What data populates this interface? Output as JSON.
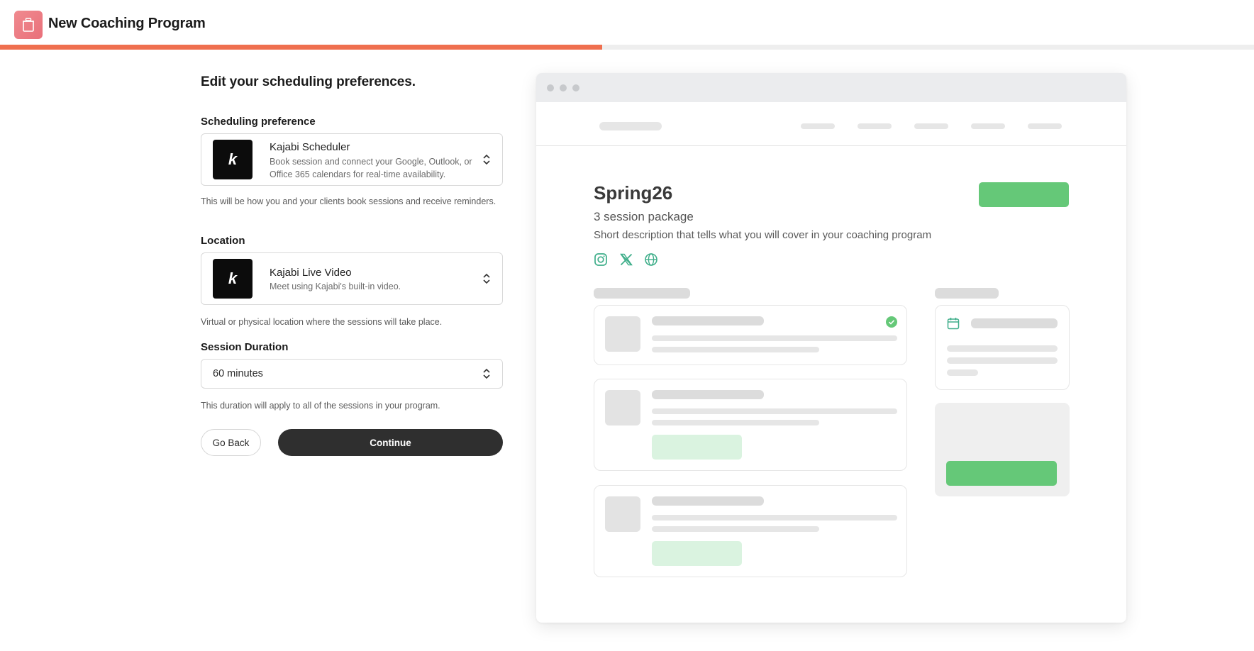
{
  "header": {
    "title": "New Coaching Program",
    "progress_fraction": 0.48,
    "progress_color": "#ef6f4f",
    "icon": "trash-can-icon"
  },
  "form": {
    "heading": "Edit your scheduling preferences.",
    "scheduling": {
      "label": "Scheduling preference",
      "selected_title": "Kajabi Scheduler",
      "selected_desc": "Book session and connect your Google, Outlook, or Office 365 calendars for real-time availability.",
      "logo_text": "k",
      "help": "This will be how you and your clients book sessions and receive reminders."
    },
    "location": {
      "label": "Location",
      "selected_title": "Kajabi Live Video",
      "selected_desc": "Meet using Kajabi's built-in video.",
      "logo_text": "k",
      "help": "Virtual or physical location where the sessions will take place."
    },
    "duration": {
      "label": "Session Duration",
      "value": "60 minutes",
      "help": "This duration will apply to all of the sessions in your program."
    },
    "buttons": {
      "back": "Go Back",
      "continue": "Continue"
    }
  },
  "preview": {
    "program_title": "Spring26",
    "program_subtitle": "3 session package",
    "program_description": "Short description that tells what you will cover in your coaching program",
    "social_icons": [
      "instagram-icon",
      "x-twitter-icon",
      "globe-icon"
    ],
    "accent_color": "#65c878",
    "icon_color": "#3fae8a"
  }
}
